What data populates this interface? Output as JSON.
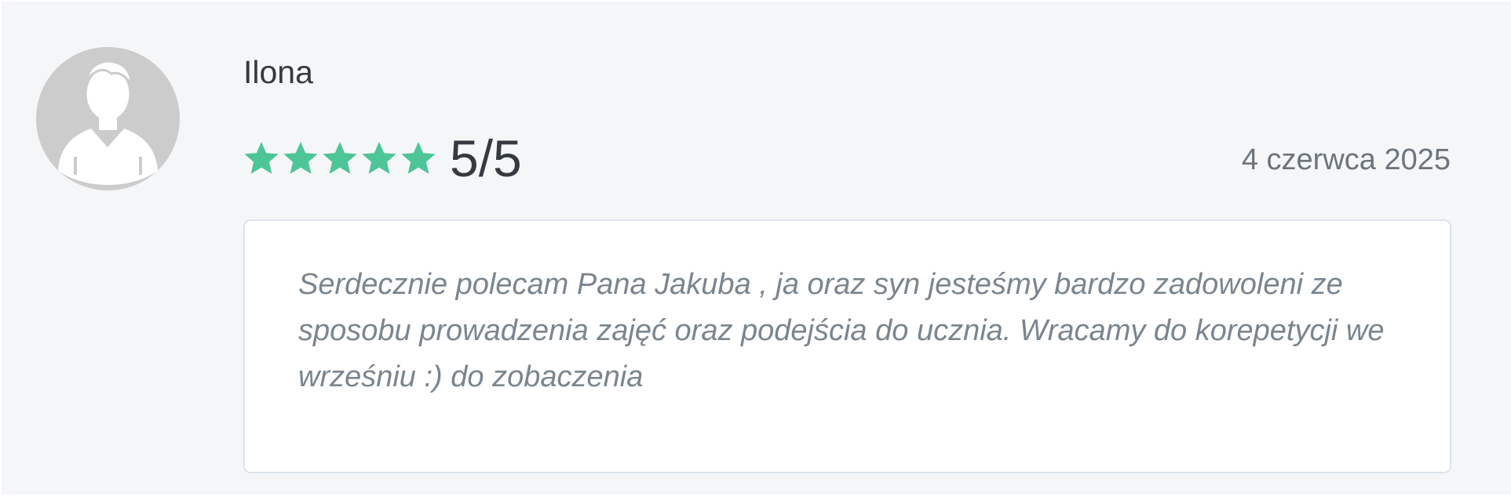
{
  "review": {
    "author": "Ilona",
    "rating_value": 5,
    "rating_max": 5,
    "rating_label": "5/5",
    "date": "4 czerwca 2025",
    "text": "Serdecznie polecam Pana Jakuba , ja oraz syn jesteśmy bardzo zadowoleni ze sposobu prowadzenia zajęć oraz podejścia do ucznia. Wracamy do korepetycji we wrześniu :) do zobaczenia"
  },
  "icons": {
    "avatar": "default-user-avatar-icon",
    "star": "star-icon"
  },
  "colors": {
    "background": "#f5f6f8",
    "star": "#4dc596",
    "avatar_bg": "#cccccc",
    "text_dark": "#343a40",
    "text_muted": "#6c757d",
    "review_border": "#dce3ea"
  }
}
